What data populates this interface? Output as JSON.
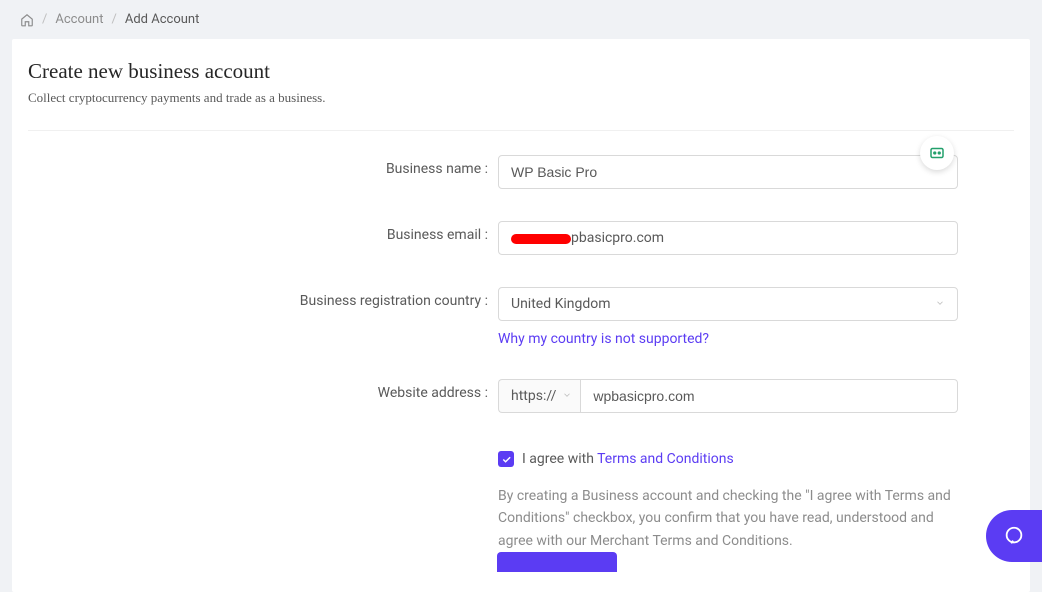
{
  "breadcrumb": {
    "account": "Account",
    "addAccount": "Add Account"
  },
  "header": {
    "title": "Create new business account",
    "subtitle": "Collect cryptocurrency payments and trade as a business."
  },
  "form": {
    "businessName": {
      "label": "Business name :",
      "value": "WP Basic Pro"
    },
    "businessEmail": {
      "label": "Business email :",
      "domainPart": "pbasicpro.com"
    },
    "country": {
      "label": "Business registration country :",
      "value": "United Kingdom",
      "helpLink": "Why my country is not supported?"
    },
    "website": {
      "label": "Website address :",
      "protocol": "https://",
      "value": "wpbasicpro.com"
    },
    "agree": {
      "prefix": "I agree with ",
      "linkText": "Terms and Conditions"
    },
    "disclaimer": "By creating a Business account and checking the \"I agree with Terms and Conditions\" checkbox, you confirm that you have read, understood and agree with our Merchant Terms and Conditions."
  }
}
